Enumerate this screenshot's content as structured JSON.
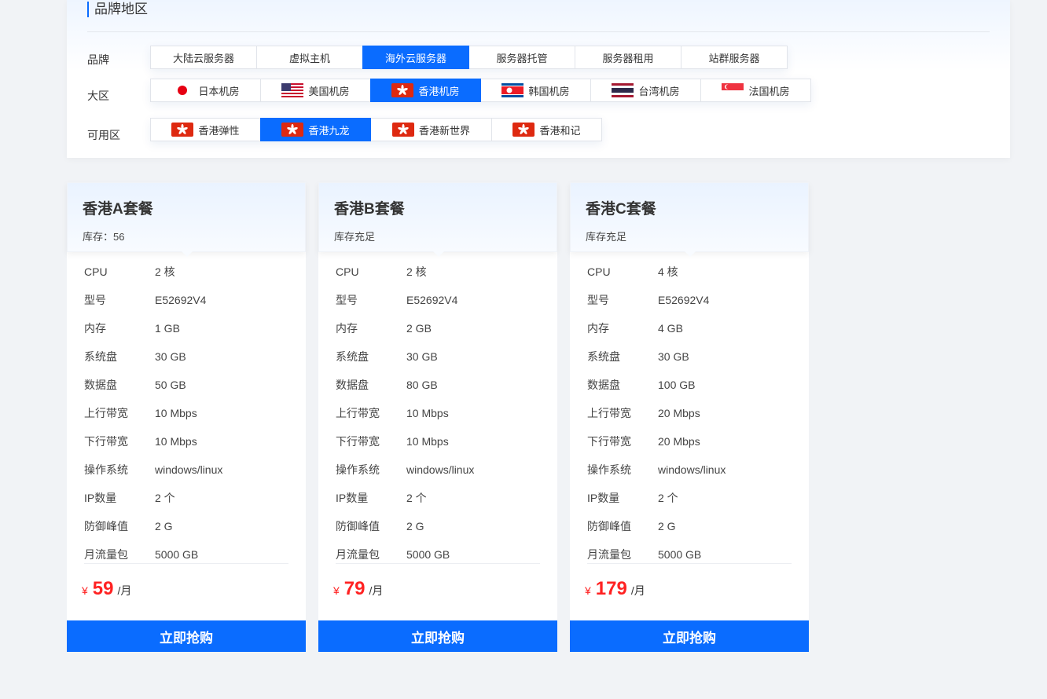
{
  "panel": {
    "title": "品牌地区",
    "brand_label": "品牌",
    "region_label": "大区",
    "zone_label": "可用区"
  },
  "brands": [
    {
      "label": "大陆云服务器",
      "active": false
    },
    {
      "label": "虚拟主机",
      "active": false
    },
    {
      "label": "海外云服务器",
      "active": true
    },
    {
      "label": "服务器托管",
      "active": false
    },
    {
      "label": "服务器租用",
      "active": false
    },
    {
      "label": "站群服务器",
      "active": false
    }
  ],
  "regions": [
    {
      "label": "日本机房",
      "flag": "japan-flag-icon",
      "active": false
    },
    {
      "label": "美国机房",
      "flag": "usa-flag-icon",
      "active": false
    },
    {
      "label": "香港机房",
      "flag": "hongkong-flag-icon",
      "active": true
    },
    {
      "label": "韩国机房",
      "flag": "korea-flag-icon",
      "active": false
    },
    {
      "label": "台湾机房",
      "flag": "thailand-flag-icon",
      "active": false
    },
    {
      "label": "法国机房",
      "flag": "singapore-flag-icon",
      "active": false
    }
  ],
  "zones": [
    {
      "label": "香港弹性",
      "flag": "hongkong-flag-icon",
      "active": false
    },
    {
      "label": "香港九龙",
      "flag": "hongkong-flag-icon",
      "active": true
    },
    {
      "label": "香港新世界",
      "flag": "hongkong-flag-icon",
      "active": false
    },
    {
      "label": "香港和记",
      "flag": "hongkong-flag-icon",
      "active": false
    }
  ],
  "spec_labels": [
    "CPU",
    "型号",
    "内存",
    "系统盘",
    "数据盘",
    "上行带宽",
    "下行带宽",
    "操作系统",
    "IP数量",
    "防御峰值",
    "月流量包"
  ],
  "plans": [
    {
      "name": "香港A套餐",
      "stock": "库存：56",
      "specs": [
        "2 核",
        "E52692V4",
        "1 GB",
        "30 GB",
        "50 GB",
        "10 Mbps",
        "10 Mbps",
        "windows/linux",
        "2 个",
        "2 G",
        "5000 GB"
      ],
      "currency": "¥",
      "price": "59",
      "unit": "/月",
      "button": "立即抢购"
    },
    {
      "name": "香港B套餐",
      "stock": "库存充足",
      "specs": [
        "2 核",
        "E52692V4",
        "2 GB",
        "30 GB",
        "80 GB",
        "10 Mbps",
        "10 Mbps",
        "windows/linux",
        "2 个",
        "2 G",
        "5000 GB"
      ],
      "currency": "¥",
      "price": "79",
      "unit": "/月",
      "button": "立即抢购"
    },
    {
      "name": "香港C套餐",
      "stock": "库存充足",
      "specs": [
        "4 核",
        "E52692V4",
        "4 GB",
        "30 GB",
        "100 GB",
        "20 Mbps",
        "20 Mbps",
        "windows/linux",
        "2 个",
        "2 G",
        "5000 GB"
      ],
      "currency": "¥",
      "price": "179",
      "unit": "/月",
      "button": "立即抢购"
    }
  ],
  "colors": {
    "accent": "#0a6cff",
    "price": "#ff2222"
  }
}
